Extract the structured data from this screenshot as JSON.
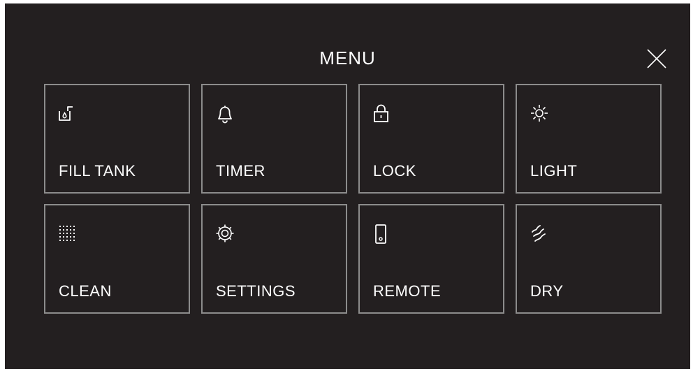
{
  "header": {
    "title": "MENU"
  },
  "tiles": [
    {
      "label": "FILL TANK",
      "icon": "fill-tank-icon"
    },
    {
      "label": "TIMER",
      "icon": "bell-icon"
    },
    {
      "label": "LOCK",
      "icon": "lock-icon"
    },
    {
      "label": "LIGHT",
      "icon": "sun-icon"
    },
    {
      "label": "CLEAN",
      "icon": "dot-grid-icon"
    },
    {
      "label": "SETTINGS",
      "icon": "gear-icon"
    },
    {
      "label": "REMOTE",
      "icon": "phone-icon"
    },
    {
      "label": "DRY",
      "icon": "air-waves-icon"
    }
  ],
  "colors": {
    "background": "#231f20",
    "tile_border": "#8c8c8c",
    "text": "#ffffff"
  }
}
